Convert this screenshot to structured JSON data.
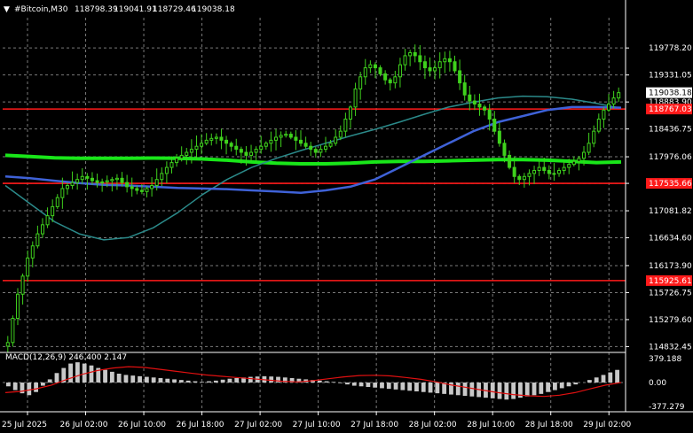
{
  "header": {
    "symbol": "#Bitcoin,M30",
    "open": "118798.39",
    "high": "119041.91",
    "low": "118729.46",
    "close": "119038.18"
  },
  "macd_label": "MACD(12,26,9) 246.400 2.147",
  "colors": {
    "background": "#000000",
    "grid": "#7a7a7a",
    "bull": "#3fd11d",
    "bear": "#3fd11d",
    "ma_teal": "#2b8a8a",
    "ma_blue": "#3f62d8",
    "ma_green": "#19e619",
    "level": "#ff1a1a",
    "macd_hist": "#c8c8c8",
    "macd_signal": "#e01010",
    "axis_text": "#ffffff",
    "price_tag_bg": "#ffffff",
    "price_tag_text": "#000000"
  },
  "chart_data": {
    "type": "candlestick",
    "title": "#Bitcoin,M30",
    "price_axis_ticks": [
      "119778.20",
      "119331.05",
      "118883.90",
      "118436.75",
      "117976.06",
      "117535.66",
      "117081.82",
      "116634.60",
      "116173.90",
      "115726.75",
      "115279.60",
      "114832.45"
    ],
    "ylim": [
      114780,
      120250
    ],
    "time_axis_ticks": [
      "25 Jul 2025",
      "26 Jul 02:00",
      "26 Jul 10:00",
      "26 Jul 18:00",
      "27 Jul 02:00",
      "27 Jul 10:00",
      "27 Jul 18:00",
      "28 Jul 02:00",
      "28 Jul 10:00",
      "28 Jul 18:00",
      "29 Jul 02:00"
    ],
    "current_price": "119038.18",
    "levels": [
      {
        "price": 118767.03,
        "label": "118767.03"
      },
      {
        "price": 117535.66,
        "label": "117535.66"
      },
      {
        "price": 115925.61,
        "label": "115925.61"
      }
    ],
    "ohlc_close": [
      114900,
      115300,
      115700,
      116000,
      116300,
      116500,
      116700,
      116850,
      117000,
      117150,
      117300,
      117450,
      117500,
      117550,
      117600,
      117650,
      117620,
      117580,
      117550,
      117560,
      117580,
      117600,
      117620,
      117550,
      117480,
      117450,
      117420,
      117400,
      117450,
      117500,
      117600,
      117700,
      117800,
      117880,
      117950,
      118000,
      118050,
      118100,
      118150,
      118200,
      118250,
      118280,
      118300,
      118250,
      118200,
      118150,
      118100,
      118050,
      118000,
      118050,
      118100,
      118150,
      118200,
      118250,
      118300,
      118330,
      118350,
      118300,
      118250,
      118200,
      118150,
      118100,
      118050,
      118100,
      118150,
      118200,
      118300,
      118400,
      118600,
      118800,
      119100,
      119300,
      119450,
      119500,
      119450,
      119350,
      119250,
      119200,
      119300,
      119500,
      119650,
      119700,
      119650,
      119550,
      119450,
      119400,
      119450,
      119550,
      119600,
      119550,
      119400,
      119200,
      119000,
      118900,
      118850,
      118800,
      118750,
      118600,
      118400,
      118200,
      118000,
      117800,
      117650,
      117600,
      117650,
      117700,
      117750,
      117800,
      117750,
      117700,
      117700,
      117750,
      117800,
      117850,
      117900,
      117950,
      118050,
      118200,
      118400,
      118600,
      118750,
      118850,
      118950,
      119038
    ],
    "ma_teal": [
      117500,
      117200,
      116900,
      116700,
      116600,
      116640,
      116800,
      117050,
      117350,
      117600,
      117800,
      117950,
      118080,
      118200,
      118320,
      118430,
      118550,
      118680,
      118800,
      118880,
      118950,
      118980,
      118970,
      118930,
      118860,
      118780
    ],
    "ma_blue": [
      117650,
      117620,
      117580,
      117540,
      117510,
      117500,
      117480,
      117460,
      117450,
      117440,
      117420,
      117400,
      117380,
      117420,
      117480,
      117600,
      117800,
      118000,
      118200,
      118400,
      118550,
      118650,
      118750,
      118800,
      118800,
      118790
    ],
    "ma_green": [
      118000,
      117980,
      117960,
      117950,
      117950,
      117950,
      117955,
      117950,
      117940,
      117920,
      117890,
      117870,
      117860,
      117860,
      117870,
      117890,
      117900,
      117900,
      117910,
      117920,
      117930,
      117930,
      117920,
      117900,
      117880,
      117890
    ],
    "macd_axis_ticks": [
      "379.188",
      "0.00",
      "-377.279"
    ],
    "macd_ylim": [
      -420,
      420
    ],
    "macd_hist": [
      -60,
      -120,
      -170,
      -200,
      -150,
      -50,
      50,
      150,
      230,
      300,
      320,
      300,
      270,
      230,
      200,
      170,
      140,
      120,
      110,
      100,
      90,
      80,
      70,
      60,
      50,
      40,
      30,
      20,
      10,
      20,
      30,
      45,
      60,
      70,
      80,
      90,
      95,
      100,
      95,
      90,
      80,
      70,
      60,
      50,
      40,
      30,
      20,
      10,
      -10,
      -30,
      -50,
      -60,
      -70,
      -80,
      -90,
      -100,
      -110,
      -120,
      -130,
      -140,
      -150,
      -160,
      -170,
      -180,
      -190,
      -200,
      -210,
      -220,
      -230,
      -240,
      -250,
      -260,
      -270,
      -260,
      -240,
      -220,
      -200,
      -180,
      -150,
      -120,
      -90,
      -60,
      -30,
      0,
      40,
      80,
      120,
      160,
      200
    ],
    "macd_signal": [
      -160,
      -140,
      -100,
      -40,
      50,
      130,
      190,
      230,
      250,
      240,
      210,
      180,
      150,
      120,
      100,
      80,
      60,
      40,
      20,
      10,
      30,
      60,
      90,
      110,
      115,
      105,
      80,
      50,
      10,
      -40,
      -80,
      -120,
      -160,
      -190,
      -210,
      -220,
      -200,
      -160,
      -100,
      -40,
      0
    ]
  }
}
